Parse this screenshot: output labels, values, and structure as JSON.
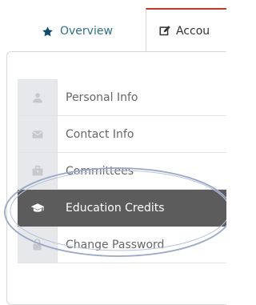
{
  "tabs": {
    "overview_label": "Overview",
    "account_label": "Accou",
    "accent": "#c0392b",
    "overview_color": "#2f6f86"
  },
  "menu": {
    "items": [
      {
        "label": "Personal Info",
        "icon": "user-icon"
      },
      {
        "label": "Contact Info",
        "icon": "envelope-icon"
      },
      {
        "label": "Committees",
        "icon": "briefcase-icon"
      },
      {
        "label": "Education Credits",
        "icon": "graduation-cap-icon",
        "active": true
      },
      {
        "label": "Change Password",
        "icon": "lock-icon"
      }
    ],
    "active_bg": "#5c5c5c",
    "icon_bg": "#e6e8eb"
  },
  "annotation": {
    "shape": "ellipse",
    "color": "#9aa8c8"
  }
}
